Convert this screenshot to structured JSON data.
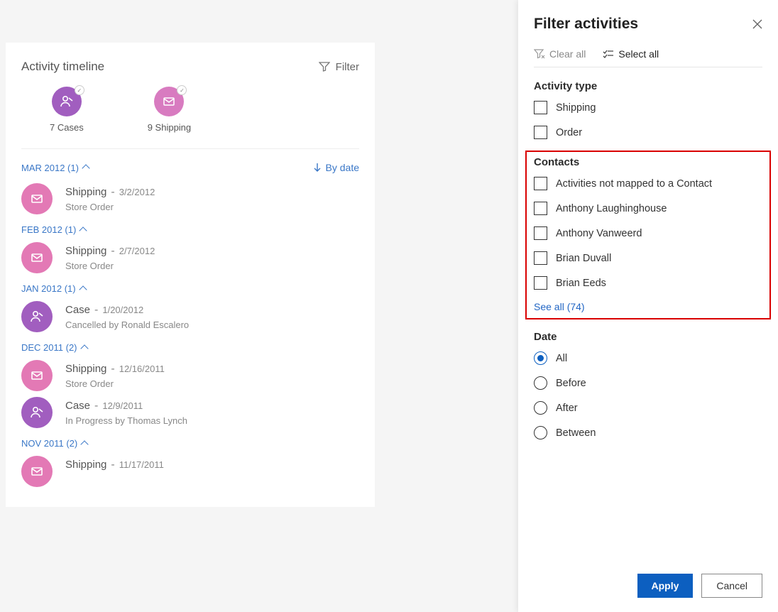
{
  "timeline": {
    "title": "Activity timeline",
    "filter_label": "Filter",
    "summary": {
      "cases": {
        "label": "7 Cases",
        "icon": "person-icon"
      },
      "shipping": {
        "label": "9 Shipping",
        "icon": "mail-icon"
      }
    },
    "sort_label": "By date",
    "groups": [
      {
        "header": "MAR 2012 (1)",
        "items": [
          {
            "type": "Shipping",
            "date": "3/2/2012",
            "sub": "Store Order",
            "kind": "ship"
          }
        ]
      },
      {
        "header": "FEB 2012 (1)",
        "items": [
          {
            "type": "Shipping",
            "date": "2/7/2012",
            "sub": "Store Order",
            "kind": "ship"
          }
        ]
      },
      {
        "header": "JAN 2012 (1)",
        "items": [
          {
            "type": "Case",
            "date": "1/20/2012",
            "sub": "Cancelled by Ronald Escalero",
            "kind": "case"
          }
        ]
      },
      {
        "header": "DEC 2011 (2)",
        "items": [
          {
            "type": "Shipping",
            "date": "12/16/2011",
            "sub": "Store Order",
            "kind": "ship"
          },
          {
            "type": "Case",
            "date": "12/9/2011",
            "sub": "In Progress by Thomas Lynch",
            "kind": "case"
          }
        ]
      },
      {
        "header": "NOV 2011 (2)",
        "items": [
          {
            "type": "Shipping",
            "date": "11/17/2011",
            "sub": "",
            "kind": "ship"
          }
        ]
      }
    ]
  },
  "panel": {
    "title": "Filter activities",
    "clear_label": "Clear all",
    "select_label": "Select all",
    "activity_type_title": "Activity type",
    "activity_types": [
      "Shipping",
      "Order"
    ],
    "contacts_title": "Contacts",
    "contacts": [
      "Activities not mapped to a Contact",
      "Anthony Laughinghouse",
      "Anthony Vanweerd",
      "Brian Duvall",
      "Brian Eeds"
    ],
    "see_all_label": "See all (74)",
    "date_title": "Date",
    "date_options": [
      "All",
      "Before",
      "After",
      "Between"
    ],
    "date_selected": "All",
    "apply_label": "Apply",
    "cancel_label": "Cancel"
  }
}
